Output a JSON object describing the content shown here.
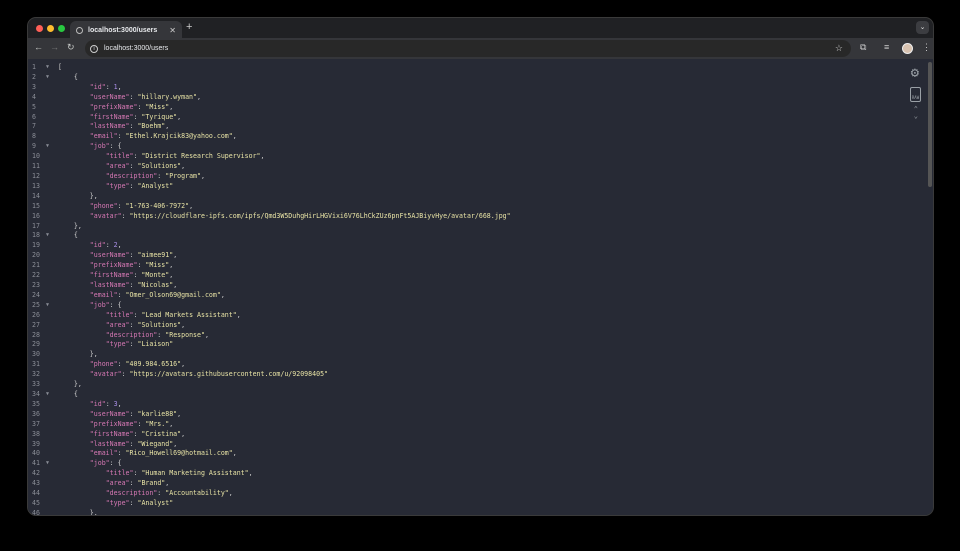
{
  "browser": {
    "tab_title": "localhost:3000/users",
    "url": "localhost:3000/users",
    "new_tab": "+",
    "close": "✕"
  },
  "colors": {
    "key": "#d678b4",
    "string": "#e9e4a6",
    "number": "#a98ee6",
    "background": "#272a35"
  },
  "lines": [
    {
      "n": "1",
      "f": true,
      "i": 0,
      "t": [
        [
          "p",
          "["
        ]
      ]
    },
    {
      "n": "2",
      "f": true,
      "i": 1,
      "t": [
        [
          "p",
          "{"
        ]
      ]
    },
    {
      "n": "3",
      "i": 2,
      "t": [
        [
          "k",
          "\"id\""
        ],
        [
          "p",
          ": "
        ],
        [
          "n",
          "1"
        ],
        [
          "p",
          ","
        ]
      ]
    },
    {
      "n": "4",
      "i": 2,
      "t": [
        [
          "k",
          "\"userName\""
        ],
        [
          "p",
          ": "
        ],
        [
          "s",
          "\"hillary.wyman\""
        ],
        [
          "p",
          ","
        ]
      ]
    },
    {
      "n": "5",
      "i": 2,
      "t": [
        [
          "k",
          "\"prefixName\""
        ],
        [
          "p",
          ": "
        ],
        [
          "s",
          "\"Miss\""
        ],
        [
          "p",
          ","
        ]
      ]
    },
    {
      "n": "6",
      "i": 2,
      "t": [
        [
          "k",
          "\"firstName\""
        ],
        [
          "p",
          ": "
        ],
        [
          "s",
          "\"Tyrique\""
        ],
        [
          "p",
          ","
        ]
      ]
    },
    {
      "n": "7",
      "i": 2,
      "t": [
        [
          "k",
          "\"lastName\""
        ],
        [
          "p",
          ": "
        ],
        [
          "s",
          "\"Boehm\""
        ],
        [
          "p",
          ","
        ]
      ]
    },
    {
      "n": "8",
      "i": 2,
      "t": [
        [
          "k",
          "\"email\""
        ],
        [
          "p",
          ": "
        ],
        [
          "s",
          "\"Ethel.Krajcik83@yahoo.com\""
        ],
        [
          "p",
          ","
        ]
      ]
    },
    {
      "n": "9",
      "f": true,
      "i": 2,
      "t": [
        [
          "k",
          "\"job\""
        ],
        [
          "p",
          ": {"
        ]
      ]
    },
    {
      "n": "10",
      "i": 3,
      "t": [
        [
          "k",
          "\"title\""
        ],
        [
          "p",
          ": "
        ],
        [
          "s",
          "\"District Research Supervisor\""
        ],
        [
          "p",
          ","
        ]
      ]
    },
    {
      "n": "11",
      "i": 3,
      "t": [
        [
          "k",
          "\"area\""
        ],
        [
          "p",
          ": "
        ],
        [
          "s",
          "\"Solutions\""
        ],
        [
          "p",
          ","
        ]
      ]
    },
    {
      "n": "12",
      "i": 3,
      "t": [
        [
          "k",
          "\"description\""
        ],
        [
          "p",
          ": "
        ],
        [
          "s",
          "\"Program\""
        ],
        [
          "p",
          ","
        ]
      ]
    },
    {
      "n": "13",
      "i": 3,
      "t": [
        [
          "k",
          "\"type\""
        ],
        [
          "p",
          ": "
        ],
        [
          "s",
          "\"Analyst\""
        ]
      ]
    },
    {
      "n": "14",
      "i": 2,
      "t": [
        [
          "p",
          "},"
        ]
      ]
    },
    {
      "n": "15",
      "i": 2,
      "t": [
        [
          "k",
          "\"phone\""
        ],
        [
          "p",
          ": "
        ],
        [
          "s",
          "\"1-763-406-7972\""
        ],
        [
          "p",
          ","
        ]
      ]
    },
    {
      "n": "16",
      "i": 2,
      "t": [
        [
          "k",
          "\"avatar\""
        ],
        [
          "p",
          ": "
        ],
        [
          "s",
          "\"https://cloudflare-ipfs.com/ipfs/Qmd3W5DuhgHirLHGVixi6V76LhCkZUz6pnFt5AJBiyvHye/avatar/668.jpg\""
        ]
      ]
    },
    {
      "n": "17",
      "i": 1,
      "t": [
        [
          "p",
          "},"
        ]
      ]
    },
    {
      "n": "18",
      "f": true,
      "i": 1,
      "t": [
        [
          "p",
          "{"
        ]
      ]
    },
    {
      "n": "19",
      "i": 2,
      "t": [
        [
          "k",
          "\"id\""
        ],
        [
          "p",
          ": "
        ],
        [
          "n",
          "2"
        ],
        [
          "p",
          ","
        ]
      ]
    },
    {
      "n": "20",
      "i": 2,
      "t": [
        [
          "k",
          "\"userName\""
        ],
        [
          "p",
          ": "
        ],
        [
          "s",
          "\"aimee91\""
        ],
        [
          "p",
          ","
        ]
      ]
    },
    {
      "n": "21",
      "i": 2,
      "t": [
        [
          "k",
          "\"prefixName\""
        ],
        [
          "p",
          ": "
        ],
        [
          "s",
          "\"Miss\""
        ],
        [
          "p",
          ","
        ]
      ]
    },
    {
      "n": "22",
      "i": 2,
      "t": [
        [
          "k",
          "\"firstName\""
        ],
        [
          "p",
          ": "
        ],
        [
          "s",
          "\"Monte\""
        ],
        [
          "p",
          ","
        ]
      ]
    },
    {
      "n": "23",
      "i": 2,
      "t": [
        [
          "k",
          "\"lastName\""
        ],
        [
          "p",
          ": "
        ],
        [
          "s",
          "\"Nicolas\""
        ],
        [
          "p",
          ","
        ]
      ]
    },
    {
      "n": "24",
      "i": 2,
      "t": [
        [
          "k",
          "\"email\""
        ],
        [
          "p",
          ": "
        ],
        [
          "s",
          "\"Omer_Olson69@gmail.com\""
        ],
        [
          "p",
          ","
        ]
      ]
    },
    {
      "n": "25",
      "f": true,
      "i": 2,
      "t": [
        [
          "k",
          "\"job\""
        ],
        [
          "p",
          ": {"
        ]
      ]
    },
    {
      "n": "26",
      "i": 3,
      "t": [
        [
          "k",
          "\"title\""
        ],
        [
          "p",
          ": "
        ],
        [
          "s",
          "\"Lead Markets Assistant\""
        ],
        [
          "p",
          ","
        ]
      ]
    },
    {
      "n": "27",
      "i": 3,
      "t": [
        [
          "k",
          "\"area\""
        ],
        [
          "p",
          ": "
        ],
        [
          "s",
          "\"Solutions\""
        ],
        [
          "p",
          ","
        ]
      ]
    },
    {
      "n": "28",
      "i": 3,
      "t": [
        [
          "k",
          "\"description\""
        ],
        [
          "p",
          ": "
        ],
        [
          "s",
          "\"Response\""
        ],
        [
          "p",
          ","
        ]
      ]
    },
    {
      "n": "29",
      "i": 3,
      "t": [
        [
          "k",
          "\"type\""
        ],
        [
          "p",
          ": "
        ],
        [
          "s",
          "\"Liaison\""
        ]
      ]
    },
    {
      "n": "30",
      "i": 2,
      "t": [
        [
          "p",
          "},"
        ]
      ]
    },
    {
      "n": "31",
      "i": 2,
      "t": [
        [
          "k",
          "\"phone\""
        ],
        [
          "p",
          ": "
        ],
        [
          "s",
          "\"409.984.6516\""
        ],
        [
          "p",
          ","
        ]
      ]
    },
    {
      "n": "32",
      "i": 2,
      "t": [
        [
          "k",
          "\"avatar\""
        ],
        [
          "p",
          ": "
        ],
        [
          "s",
          "\"https://avatars.githubusercontent.com/u/92098405\""
        ]
      ]
    },
    {
      "n": "33",
      "i": 1,
      "t": [
        [
          "p",
          "},"
        ]
      ]
    },
    {
      "n": "34",
      "f": true,
      "i": 1,
      "t": [
        [
          "p",
          "{"
        ]
      ]
    },
    {
      "n": "35",
      "i": 2,
      "t": [
        [
          "k",
          "\"id\""
        ],
        [
          "p",
          ": "
        ],
        [
          "n",
          "3"
        ],
        [
          "p",
          ","
        ]
      ]
    },
    {
      "n": "36",
      "i": 2,
      "t": [
        [
          "k",
          "\"userName\""
        ],
        [
          "p",
          ": "
        ],
        [
          "s",
          "\"karlie88\""
        ],
        [
          "p",
          ","
        ]
      ]
    },
    {
      "n": "37",
      "i": 2,
      "t": [
        [
          "k",
          "\"prefixName\""
        ],
        [
          "p",
          ": "
        ],
        [
          "s",
          "\"Mrs.\""
        ],
        [
          "p",
          ","
        ]
      ]
    },
    {
      "n": "38",
      "i": 2,
      "t": [
        [
          "k",
          "\"firstName\""
        ],
        [
          "p",
          ": "
        ],
        [
          "s",
          "\"Cristina\""
        ],
        [
          "p",
          ","
        ]
      ]
    },
    {
      "n": "39",
      "i": 2,
      "t": [
        [
          "k",
          "\"lastName\""
        ],
        [
          "p",
          ": "
        ],
        [
          "s",
          "\"Wiegand\""
        ],
        [
          "p",
          ","
        ]
      ]
    },
    {
      "n": "40",
      "i": 2,
      "t": [
        [
          "k",
          "\"email\""
        ],
        [
          "p",
          ": "
        ],
        [
          "s",
          "\"Rico_Howell69@hotmail.com\""
        ],
        [
          "p",
          ","
        ]
      ]
    },
    {
      "n": "41",
      "f": true,
      "i": 2,
      "t": [
        [
          "k",
          "\"job\""
        ],
        [
          "p",
          ": {"
        ]
      ]
    },
    {
      "n": "42",
      "i": 3,
      "t": [
        [
          "k",
          "\"title\""
        ],
        [
          "p",
          ": "
        ],
        [
          "s",
          "\"Human Marketing Assistant\""
        ],
        [
          "p",
          ","
        ]
      ]
    },
    {
      "n": "43",
      "i": 3,
      "t": [
        [
          "k",
          "\"area\""
        ],
        [
          "p",
          ": "
        ],
        [
          "s",
          "\"Brand\""
        ],
        [
          "p",
          ","
        ]
      ]
    },
    {
      "n": "44",
      "i": 3,
      "t": [
        [
          "k",
          "\"description\""
        ],
        [
          "p",
          ": "
        ],
        [
          "s",
          "\"Accountability\""
        ],
        [
          "p",
          ","
        ]
      ]
    },
    {
      "n": "45",
      "i": 3,
      "t": [
        [
          "k",
          "\"type\""
        ],
        [
          "p",
          ": "
        ],
        [
          "s",
          "\"Analyst\""
        ]
      ]
    },
    {
      "n": "46",
      "i": 2,
      "t": [
        [
          "p",
          "},"
        ]
      ]
    }
  ]
}
